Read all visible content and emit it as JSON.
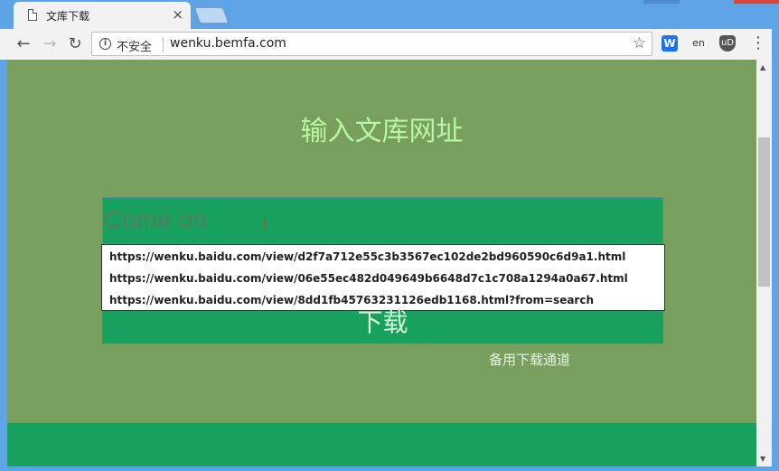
{
  "browser": {
    "tab_title": "文库下载",
    "tab_close": "×",
    "security_label": "不安全",
    "url": "wenku.bemfa.com",
    "nav_back": "←",
    "nav_forward": "→",
    "nav_reload": "↻",
    "bookmark_star": "☆",
    "menu": "⋮",
    "extensions": {
      "wenku": "W",
      "translate": "en",
      "ublock": "uD"
    }
  },
  "page": {
    "heading": "输入文库网址",
    "input_placeholder": "Come on",
    "suggestions": [
      "https://wenku.baidu.com/view/d2f7a712e55c3b3567ec102de2bd960590c6d9a1.html",
      "https://wenku.baidu.com/view/06e55ec482d049649b6648d7c1c708a1294a0a67.html",
      "https://wenku.baidu.com/view/8dd1fb45763231126edb1168.html?from=search"
    ],
    "download_button": "下载",
    "backup_link": "备用下载通道"
  },
  "colors": {
    "page_background": "#799f5e",
    "accent_green": "#17a05e",
    "heading_color": "#b9f5a6"
  }
}
